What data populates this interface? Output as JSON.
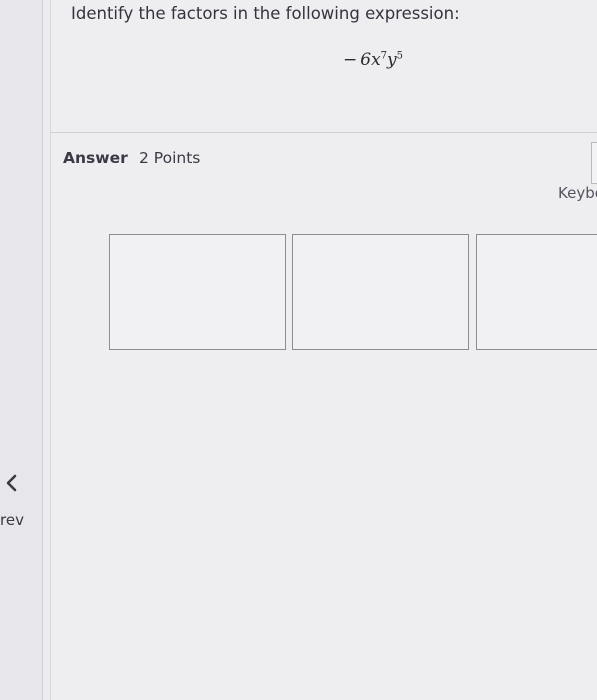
{
  "question": {
    "prompt": "Identify the factors in the following expression:",
    "expression": {
      "sign": "−",
      "coefficient": "6",
      "var1": "x",
      "exp1": "7",
      "var2": "y",
      "exp2": "5"
    }
  },
  "answer": {
    "label": "Answer",
    "points": "2 Points",
    "keyboard_link": "Keybo",
    "input_boxes": [
      {
        "value": ""
      },
      {
        "value": ""
      },
      {
        "value": ""
      }
    ]
  },
  "nav": {
    "prev_label": "rev",
    "prev_icon": "chevron-left-icon"
  }
}
